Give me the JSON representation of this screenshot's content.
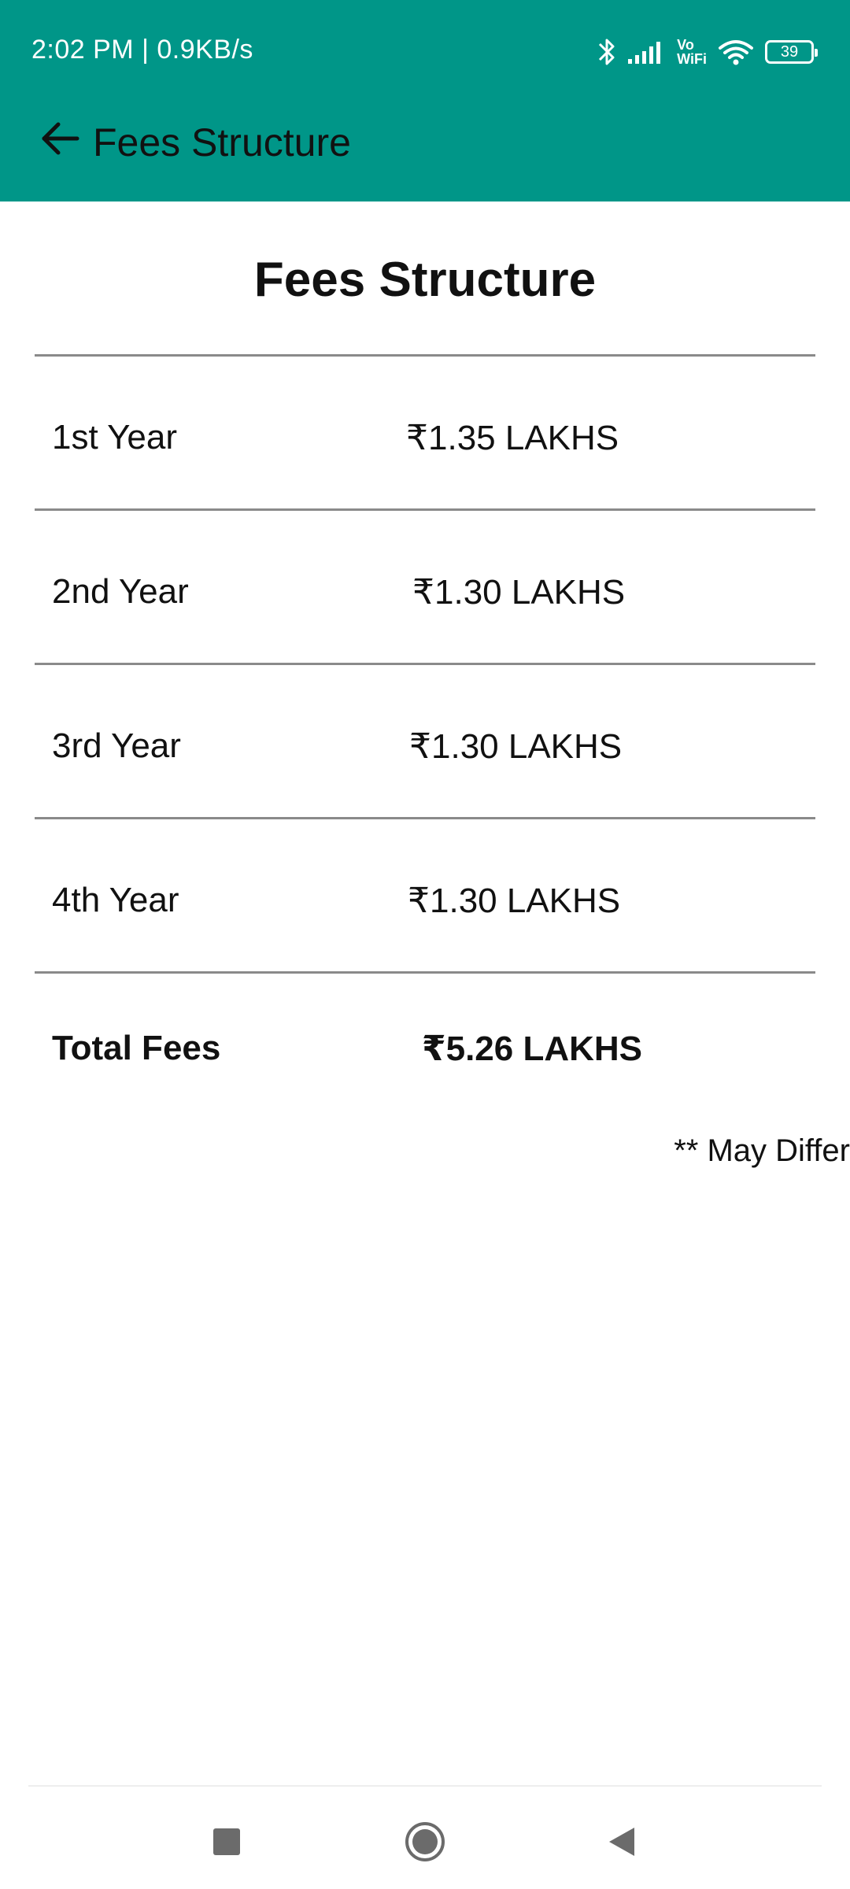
{
  "status_bar": {
    "time": "2:02 PM | 0.9KB/s",
    "vowifi_top": "Vo",
    "vowifi_bottom": "WiFi",
    "battery": "39",
    "icons": [
      "bluetooth-icon",
      "signal-icon",
      "vowifi-icon",
      "wifi-icon",
      "battery-icon"
    ]
  },
  "app_bar": {
    "back_icon": "arrow-left-icon",
    "title": "Fees Structure",
    "color": "#009688"
  },
  "content": {
    "title": "Fees Structure",
    "rows": [
      {
        "label": "1st Year",
        "value": "₹1.35 LAKHS"
      },
      {
        "label": "2nd Year",
        "value": "₹1.30 LAKHS"
      },
      {
        "label": "3rd Year",
        "value": "₹1.30 LAKHS"
      },
      {
        "label": "4th Year",
        "value": "₹1.30 LAKHS"
      }
    ],
    "total": {
      "label": "Total Fees",
      "value": "₹5.26 LAKHS"
    },
    "note": "** May Differ"
  },
  "nav_bar": {
    "icons": [
      "recents-square-icon",
      "home-circle-icon",
      "back-triangle-icon"
    ]
  }
}
